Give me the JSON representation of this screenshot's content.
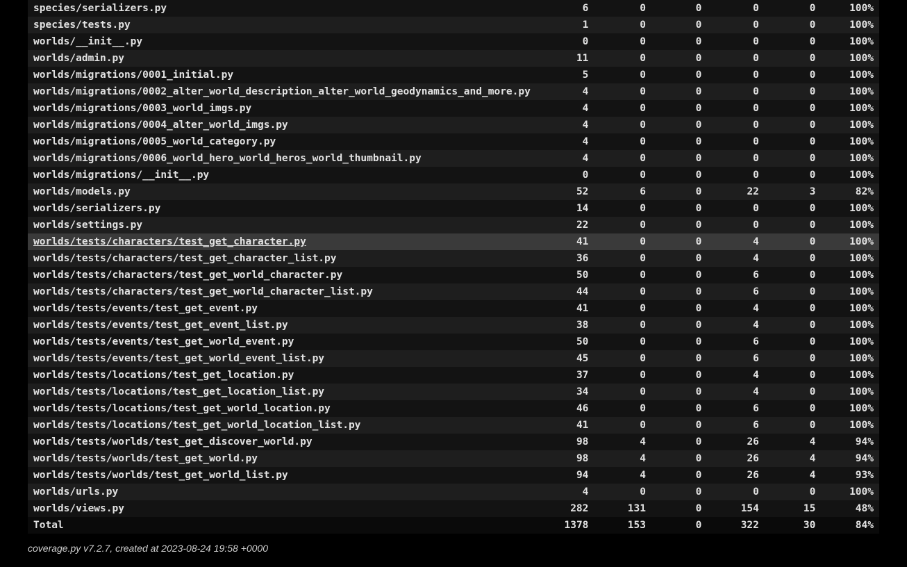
{
  "footer_text": "coverage.py v7.2.7, created at 2023-08-24 19:58 +0000",
  "hover_index": 14,
  "rows": [
    {
      "name": "species/serializers.py",
      "statements": 6,
      "missing": 0,
      "excluded": 0,
      "branches": 0,
      "partial": 0,
      "coverage": "100%"
    },
    {
      "name": "species/tests.py",
      "statements": 1,
      "missing": 0,
      "excluded": 0,
      "branches": 0,
      "partial": 0,
      "coverage": "100%"
    },
    {
      "name": "worlds/__init__.py",
      "statements": 0,
      "missing": 0,
      "excluded": 0,
      "branches": 0,
      "partial": 0,
      "coverage": "100%"
    },
    {
      "name": "worlds/admin.py",
      "statements": 11,
      "missing": 0,
      "excluded": 0,
      "branches": 0,
      "partial": 0,
      "coverage": "100%"
    },
    {
      "name": "worlds/migrations/0001_initial.py",
      "statements": 5,
      "missing": 0,
      "excluded": 0,
      "branches": 0,
      "partial": 0,
      "coverage": "100%"
    },
    {
      "name": "worlds/migrations/0002_alter_world_description_alter_world_geodynamics_and_more.py",
      "statements": 4,
      "missing": 0,
      "excluded": 0,
      "branches": 0,
      "partial": 0,
      "coverage": "100%"
    },
    {
      "name": "worlds/migrations/0003_world_imgs.py",
      "statements": 4,
      "missing": 0,
      "excluded": 0,
      "branches": 0,
      "partial": 0,
      "coverage": "100%"
    },
    {
      "name": "worlds/migrations/0004_alter_world_imgs.py",
      "statements": 4,
      "missing": 0,
      "excluded": 0,
      "branches": 0,
      "partial": 0,
      "coverage": "100%"
    },
    {
      "name": "worlds/migrations/0005_world_category.py",
      "statements": 4,
      "missing": 0,
      "excluded": 0,
      "branches": 0,
      "partial": 0,
      "coverage": "100%"
    },
    {
      "name": "worlds/migrations/0006_world_hero_world_heros_world_thumbnail.py",
      "statements": 4,
      "missing": 0,
      "excluded": 0,
      "branches": 0,
      "partial": 0,
      "coverage": "100%"
    },
    {
      "name": "worlds/migrations/__init__.py",
      "statements": 0,
      "missing": 0,
      "excluded": 0,
      "branches": 0,
      "partial": 0,
      "coverage": "100%"
    },
    {
      "name": "worlds/models.py",
      "statements": 52,
      "missing": 6,
      "excluded": 0,
      "branches": 22,
      "partial": 3,
      "coverage": "82%"
    },
    {
      "name": "worlds/serializers.py",
      "statements": 14,
      "missing": 0,
      "excluded": 0,
      "branches": 0,
      "partial": 0,
      "coverage": "100%"
    },
    {
      "name": "worlds/settings.py",
      "statements": 22,
      "missing": 0,
      "excluded": 0,
      "branches": 0,
      "partial": 0,
      "coverage": "100%"
    },
    {
      "name": "worlds/tests/characters/test_get_character.py",
      "statements": 41,
      "missing": 0,
      "excluded": 0,
      "branches": 4,
      "partial": 0,
      "coverage": "100%"
    },
    {
      "name": "worlds/tests/characters/test_get_character_list.py",
      "statements": 36,
      "missing": 0,
      "excluded": 0,
      "branches": 4,
      "partial": 0,
      "coverage": "100%"
    },
    {
      "name": "worlds/tests/characters/test_get_world_character.py",
      "statements": 50,
      "missing": 0,
      "excluded": 0,
      "branches": 6,
      "partial": 0,
      "coverage": "100%"
    },
    {
      "name": "worlds/tests/characters/test_get_world_character_list.py",
      "statements": 44,
      "missing": 0,
      "excluded": 0,
      "branches": 6,
      "partial": 0,
      "coverage": "100%"
    },
    {
      "name": "worlds/tests/events/test_get_event.py",
      "statements": 41,
      "missing": 0,
      "excluded": 0,
      "branches": 4,
      "partial": 0,
      "coverage": "100%"
    },
    {
      "name": "worlds/tests/events/test_get_event_list.py",
      "statements": 38,
      "missing": 0,
      "excluded": 0,
      "branches": 4,
      "partial": 0,
      "coverage": "100%"
    },
    {
      "name": "worlds/tests/events/test_get_world_event.py",
      "statements": 50,
      "missing": 0,
      "excluded": 0,
      "branches": 6,
      "partial": 0,
      "coverage": "100%"
    },
    {
      "name": "worlds/tests/events/test_get_world_event_list.py",
      "statements": 45,
      "missing": 0,
      "excluded": 0,
      "branches": 6,
      "partial": 0,
      "coverage": "100%"
    },
    {
      "name": "worlds/tests/locations/test_get_location.py",
      "statements": 37,
      "missing": 0,
      "excluded": 0,
      "branches": 4,
      "partial": 0,
      "coverage": "100%"
    },
    {
      "name": "worlds/tests/locations/test_get_location_list.py",
      "statements": 34,
      "missing": 0,
      "excluded": 0,
      "branches": 4,
      "partial": 0,
      "coverage": "100%"
    },
    {
      "name": "worlds/tests/locations/test_get_world_location.py",
      "statements": 46,
      "missing": 0,
      "excluded": 0,
      "branches": 6,
      "partial": 0,
      "coverage": "100%"
    },
    {
      "name": "worlds/tests/locations/test_get_world_location_list.py",
      "statements": 41,
      "missing": 0,
      "excluded": 0,
      "branches": 6,
      "partial": 0,
      "coverage": "100%"
    },
    {
      "name": "worlds/tests/worlds/test_get_discover_world.py",
      "statements": 98,
      "missing": 4,
      "excluded": 0,
      "branches": 26,
      "partial": 4,
      "coverage": "94%"
    },
    {
      "name": "worlds/tests/worlds/test_get_world.py",
      "statements": 98,
      "missing": 4,
      "excluded": 0,
      "branches": 26,
      "partial": 4,
      "coverage": "94%"
    },
    {
      "name": "worlds/tests/worlds/test_get_world_list.py",
      "statements": 94,
      "missing": 4,
      "excluded": 0,
      "branches": 26,
      "partial": 4,
      "coverage": "93%"
    },
    {
      "name": "worlds/urls.py",
      "statements": 4,
      "missing": 0,
      "excluded": 0,
      "branches": 0,
      "partial": 0,
      "coverage": "100%"
    },
    {
      "name": "worlds/views.py",
      "statements": 282,
      "missing": 131,
      "excluded": 0,
      "branches": 154,
      "partial": 15,
      "coverage": "48%"
    }
  ],
  "total": {
    "name": "Total",
    "statements": 1378,
    "missing": 153,
    "excluded": 0,
    "branches": 322,
    "partial": 30,
    "coverage": "84%"
  }
}
